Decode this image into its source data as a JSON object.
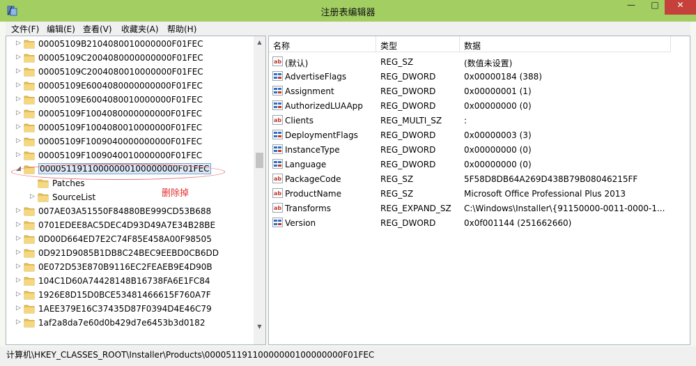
{
  "window": {
    "title": "注册表编辑器",
    "min_glyph": "—",
    "max_glyph": "□",
    "close_glyph": "✕",
    "accent": "#a2ce62",
    "close_color": "#c6413b"
  },
  "menu": [
    "文件(F)",
    "编辑(E)",
    "查看(V)",
    "收藏夹(A)",
    "帮助(H)"
  ],
  "tree": {
    "items": [
      {
        "label": "00005109B2104080010000000F01FEC",
        "level": 0,
        "expanded": false,
        "selected": false
      },
      {
        "label": "00005109C2004080000000000F01FEC",
        "level": 0,
        "expanded": false,
        "selected": false
      },
      {
        "label": "00005109C2004080010000000F01FEC",
        "level": 0,
        "expanded": false,
        "selected": false
      },
      {
        "label": "00005109E6004080000000000F01FEC",
        "level": 0,
        "expanded": false,
        "selected": false
      },
      {
        "label": "00005109E6004080010000000F01FEC",
        "level": 0,
        "expanded": false,
        "selected": false
      },
      {
        "label": "00005109F1004080000000000F01FEC",
        "level": 0,
        "expanded": false,
        "selected": false
      },
      {
        "label": "00005109F1004080010000000F01FEC",
        "level": 0,
        "expanded": false,
        "selected": false
      },
      {
        "label": "00005109F1009040000000000F01FEC",
        "level": 0,
        "expanded": false,
        "selected": false
      },
      {
        "label": "00005109F1009040010000000F01FEC",
        "level": 0,
        "expanded": false,
        "selected": false
      },
      {
        "label": "00005119110000000100000000F01FEC",
        "level": 0,
        "expanded": true,
        "selected": true
      },
      {
        "label": "Patches",
        "level": 1,
        "expanded": false,
        "selected": false,
        "no_expander": true
      },
      {
        "label": "SourceList",
        "level": 1,
        "expanded": false,
        "selected": false
      },
      {
        "label": "007AE03A51550F84880BE999CD53B688",
        "level": 0,
        "expanded": false,
        "selected": false
      },
      {
        "label": "0701EDEE8AC5DEC4D93D49A7E34B28BE",
        "level": 0,
        "expanded": false,
        "selected": false
      },
      {
        "label": "0D00D664ED7E2C74F85E458A00F98505",
        "level": 0,
        "expanded": false,
        "selected": false
      },
      {
        "label": "0D921D9085B1DB8C24BEC9EEBD0CB6DD",
        "level": 0,
        "expanded": false,
        "selected": false
      },
      {
        "label": "0E072D53E870B9116EC2FEAEB9E4D90B",
        "level": 0,
        "expanded": false,
        "selected": false
      },
      {
        "label": "104C1D60A74428148B16738FA6E1FC84",
        "level": 0,
        "expanded": false,
        "selected": false
      },
      {
        "label": "1926E8D15D0BCE53481466615F760A7F",
        "level": 0,
        "expanded": false,
        "selected": false
      },
      {
        "label": "1AEE379E16C37435D87F0394D4E46C79",
        "level": 0,
        "expanded": false,
        "selected": false
      },
      {
        "label": "1af2a8da7e60d0b429d7e6453b3d0182",
        "level": 0,
        "expanded": false,
        "selected": false
      }
    ]
  },
  "annotation": {
    "text": "删除掉",
    "color": "#e43030"
  },
  "list": {
    "columns": [
      "名称",
      "类型",
      "数据"
    ],
    "rows": [
      {
        "name": "(默认)",
        "type": "REG_SZ",
        "data": "(数值未设置)",
        "icon": "string-value-icon"
      },
      {
        "name": "AdvertiseFlags",
        "type": "REG_DWORD",
        "data": "0x00000184 (388)",
        "icon": "binary-value-icon"
      },
      {
        "name": "Assignment",
        "type": "REG_DWORD",
        "data": "0x00000001 (1)",
        "icon": "binary-value-icon"
      },
      {
        "name": "AuthorizedLUAApp",
        "type": "REG_DWORD",
        "data": "0x00000000 (0)",
        "icon": "binary-value-icon"
      },
      {
        "name": "Clients",
        "type": "REG_MULTI_SZ",
        "data": ":",
        "icon": "string-value-icon"
      },
      {
        "name": "DeploymentFlags",
        "type": "REG_DWORD",
        "data": "0x00000003 (3)",
        "icon": "binary-value-icon"
      },
      {
        "name": "InstanceType",
        "type": "REG_DWORD",
        "data": "0x00000000 (0)",
        "icon": "binary-value-icon"
      },
      {
        "name": "Language",
        "type": "REG_DWORD",
        "data": "0x00000000 (0)",
        "icon": "binary-value-icon"
      },
      {
        "name": "PackageCode",
        "type": "REG_SZ",
        "data": "5F58D8DB64A269D438B79B08046215FF",
        "icon": "string-value-icon"
      },
      {
        "name": "ProductName",
        "type": "REG_SZ",
        "data": "Microsoft Office Professional Plus 2013",
        "icon": "string-value-icon"
      },
      {
        "name": "Transforms",
        "type": "REG_EXPAND_SZ",
        "data": "C:\\Windows\\Installer\\{91150000-0011-0000-1...",
        "icon": "string-value-icon"
      },
      {
        "name": "Version",
        "type": "REG_DWORD",
        "data": "0x0f001144 (251662660)",
        "icon": "binary-value-icon"
      }
    ]
  },
  "status": {
    "path": "计算机\\HKEY_CLASSES_ROOT\\Installer\\Products\\00005119110000000100000000F01FEC"
  }
}
